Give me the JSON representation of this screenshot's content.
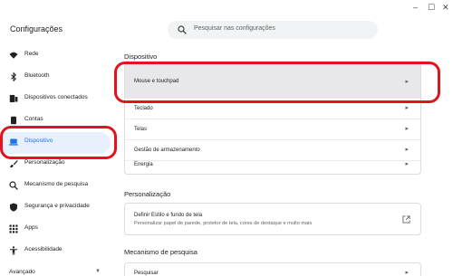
{
  "window": {
    "title": "Configurações",
    "controls": {
      "minimize": "–",
      "maximize": "☐",
      "close": "✕"
    }
  },
  "search": {
    "placeholder": "Pesquisar nas configurações",
    "icon": "search-icon"
  },
  "sidebar": {
    "items": [
      {
        "label": "Rede",
        "icon": "wifi-icon"
      },
      {
        "label": "Bluetooth",
        "icon": "bluetooth-icon"
      },
      {
        "label": "Dispositivos conectados",
        "icon": "connected-devices-icon"
      },
      {
        "label": "Contas",
        "icon": "accounts-icon"
      },
      {
        "label": "Dispositivo",
        "icon": "laptop-icon",
        "active": true
      },
      {
        "label": "Personalização",
        "icon": "brush-icon"
      },
      {
        "label": "Mecanismo de pesquisa",
        "icon": "search-icon"
      },
      {
        "label": "Segurança e privacidade",
        "icon": "shield-icon"
      },
      {
        "label": "Apps",
        "icon": "apps-grid-icon"
      },
      {
        "label": "Acessibilidade",
        "icon": "accessibility-icon"
      },
      {
        "label": "Avançado",
        "icon": "chevron-down-icon"
      }
    ]
  },
  "main": {
    "device_section": {
      "title": "Dispositivo",
      "rows": [
        {
          "label": "Mouse e touchpad",
          "arrow": "▸"
        },
        {
          "label": "Teclado",
          "arrow": "▸"
        },
        {
          "label": "Telas",
          "arrow": "▸"
        },
        {
          "label": "Gestão de armazenamento",
          "arrow": "▸"
        },
        {
          "label": "Energia",
          "arrow": "▸"
        }
      ]
    },
    "personalization_section": {
      "title": "Personalização",
      "row_title": "Definir Estilo e fundo de tela",
      "row_subtitle": "Personalizar papel de parede, protetor de tela, cores de destaque e muito mais"
    },
    "search_engine_section": {
      "title": "Mecanismo de pesquisa",
      "row_label": "Pesquisar",
      "arrow": "▸"
    }
  },
  "annotation_color": "#e3131d",
  "accent_color": "#1a73e8"
}
